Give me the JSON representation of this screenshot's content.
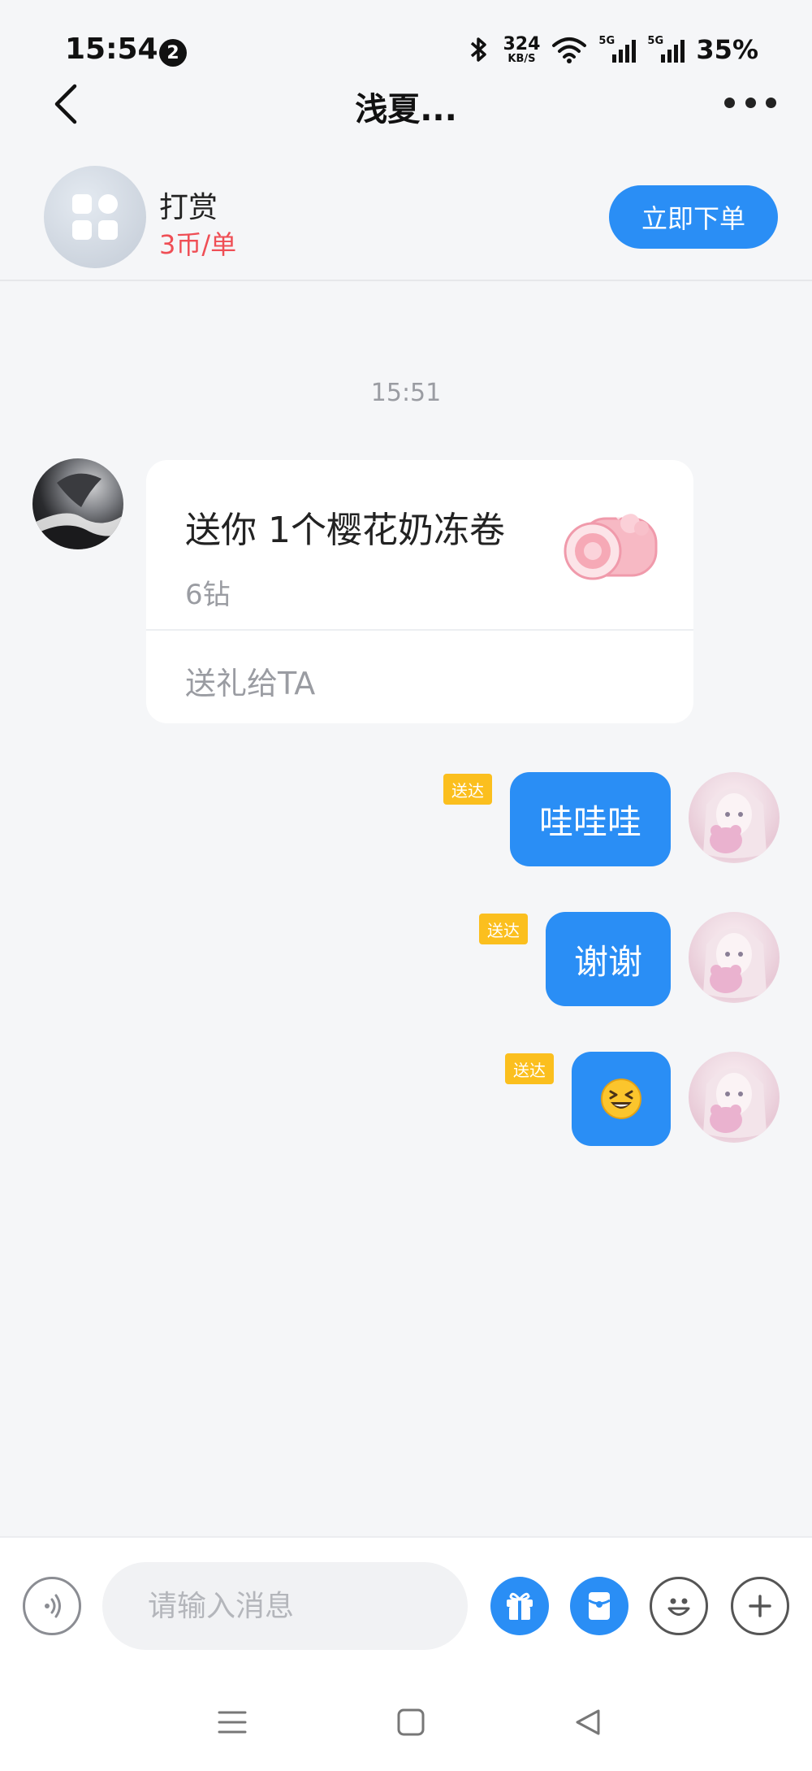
{
  "status_bar": {
    "time": "15:54",
    "notification_count": "2",
    "net_speed": "324",
    "net_speed_unit": "KB/S",
    "sim1": "5G",
    "sim2": "5G",
    "battery": "35%"
  },
  "nav": {
    "title": "浅夏...",
    "back_icon": "chevron-left-icon",
    "more_icon": "more-horizontal-icon"
  },
  "service": {
    "name": "打赏",
    "price": "3币/单",
    "order_button": "立即下单",
    "icon": "apps-grid-icon"
  },
  "chat": {
    "timestamp": "15:51",
    "gift_card": {
      "title": "送你 1个樱花奶冻卷",
      "price": "6钻",
      "action": "送礼给TA",
      "image": "sakura-roll-cake"
    },
    "messages": [
      {
        "text": "哇哇哇",
        "status": "送达"
      },
      {
        "text": "谢谢",
        "status": "送达"
      },
      {
        "text": "",
        "emoji": "laughing-squint-emoji",
        "status": "送达"
      }
    ]
  },
  "input_bar": {
    "placeholder": "请输入消息",
    "icons": [
      "voice-icon",
      "gift-icon",
      "red-packet-icon",
      "emoji-icon",
      "plus-icon"
    ]
  },
  "colors": {
    "accent": "#2a8ef5",
    "price": "#ef4e55",
    "delivered_badge": "#fbbf1e",
    "background": "#f5f6f8"
  }
}
